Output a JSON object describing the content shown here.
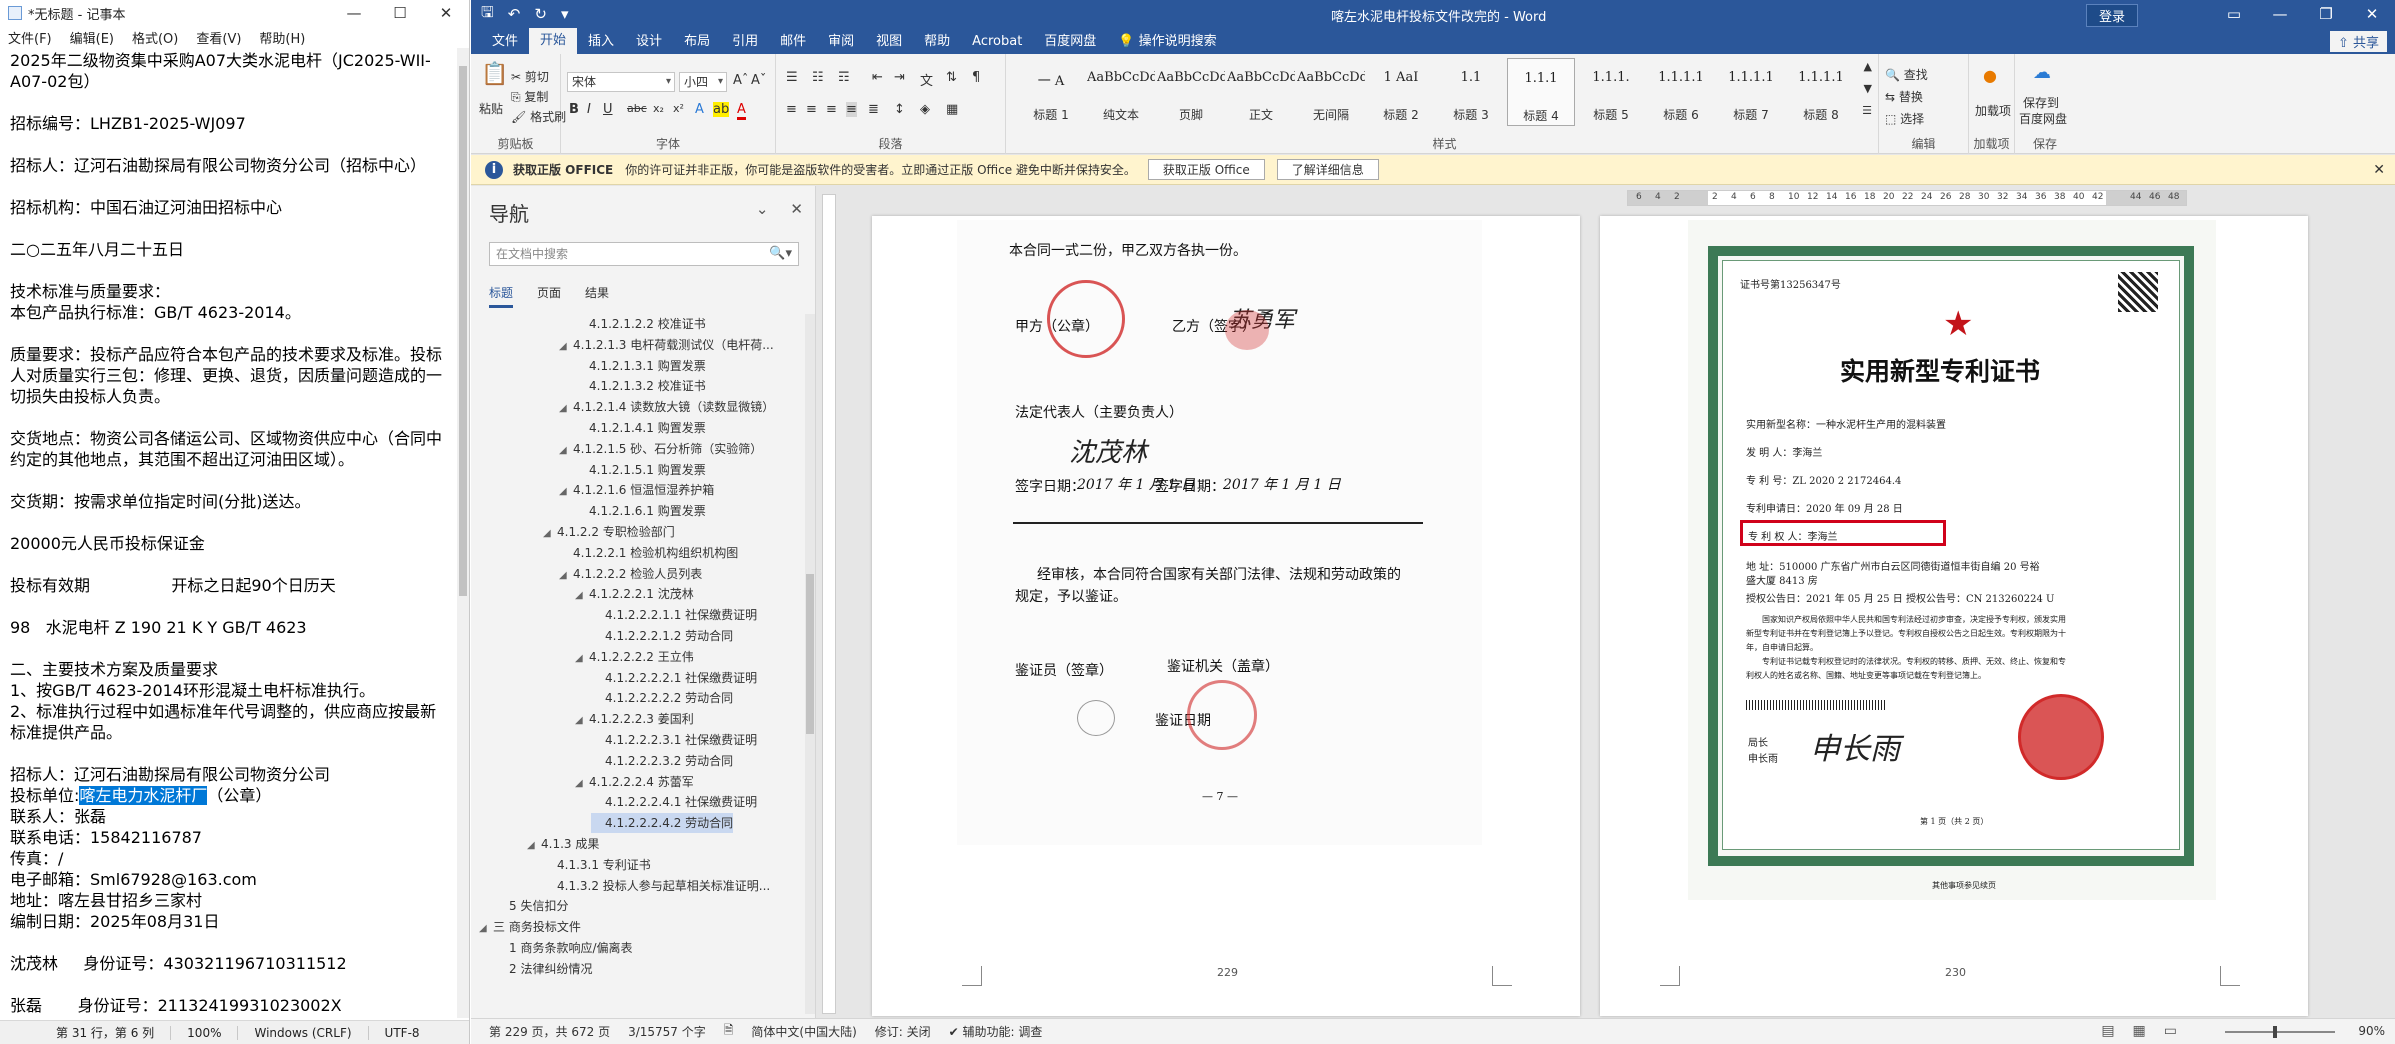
{
  "notepad": {
    "title": "*无标题 - 记事本",
    "menu": [
      "文件(F)",
      "编辑(E)",
      "格式(O)",
      "查看(V)",
      "帮助(H)"
    ],
    "lines": [
      "2025年二级物资集中采购A07大类水泥电杆（JC2025-WII-",
      "A07-02包）",
      "",
      "招标编号：LHZB1-2025-WJ097",
      "",
      "招标人：辽河石油勘探局有限公司物资分公司（招标中心）",
      "",
      "招标机构：中国石油辽河油田招标中心",
      "",
      "二○二五年八月二十五日",
      "",
      "技术标准与质量要求：",
      "本包产品执行标准：GB/T 4623-2014。",
      "",
      "质量要求：投标产品应符合本包产品的技术要求及标准。投标",
      "人对质量实行三包：修理、更换、退货，因质量问题造成的一",
      "切损失由投标人负责。",
      "",
      "交货地点：物资公司各储运公司、区域物资供应中心（合同中",
      "约定的其他地点，其范围不超出辽河油田区域）。",
      "",
      "交货期：按需求单位指定时间(分批)送达。",
      "",
      "20000元人民币投标保证金",
      "",
      "投标有效期                开标之日起90个日历天",
      "",
      "98   水泥电杆 Z 190 21 K Y GB/T 4623",
      "",
      "二、主要技术方案及质量要求",
      "1、按GB/T 4623-2014环形混凝土电杆标准执行。",
      "2、标准执行过程中如遇标准年代号调整的，供应商应按最新",
      "标准提供产品。",
      "",
      "招标人：辽河石油勘探局有限公司物资分公司"
    ],
    "bid_unit_prefix": "投标单位:",
    "bid_unit_selected": "喀左电力水泥杆厂",
    "bid_unit_suffix": "（公章）",
    "lines_after": [
      "联系人：张磊",
      "联系电话：15842116787",
      "传真：/",
      "电子邮箱：Sml67928@163.com",
      "地址：喀左县甘招乡三家村",
      "编制日期：2025年08月31日",
      "",
      "沈茂林     身份证号：430321196710311512",
      "",
      "张磊       身份证号：21132419931023002X"
    ],
    "status": {
      "position": "第 31 行，第 6 列",
      "zoom": "100%",
      "line_ending": "Windows (CRLF)",
      "encoding": "UTF-8"
    }
  },
  "word": {
    "doc_title": "喀左水泥电杆投标文件改完的 - Word",
    "login": "登录",
    "share": "共享",
    "tabs": [
      "文件",
      "开始",
      "插入",
      "设计",
      "布局",
      "引用",
      "邮件",
      "审阅",
      "视图",
      "帮助",
      "Acrobat",
      "百度网盘"
    ],
    "tell_me": "操作说明搜索",
    "ribbon": {
      "clipboard": {
        "label": "剪贴板",
        "paste": "粘贴",
        "cut": "剪切",
        "copy": "复制",
        "format_painter": "格式刷"
      },
      "font": {
        "label": "字体",
        "name": "宋体",
        "size": "小四"
      },
      "paragraph": {
        "label": "段落"
      },
      "styles": {
        "label": "样式",
        "items": [
          {
            "preview": "一  A",
            "name": "标题 1"
          },
          {
            "preview": "AaBbCcDd",
            "name": "纯文本"
          },
          {
            "preview": "AaBbCcDd",
            "name": "页脚"
          },
          {
            "preview": "AaBbCcDd",
            "name": "正文"
          },
          {
            "preview": "AaBbCcDd",
            "name": "无间隔"
          },
          {
            "preview": "1  AaI",
            "name": "标题 2"
          },
          {
            "preview": "1.1",
            "name": "标题 3"
          },
          {
            "preview": "1.1.1",
            "name": "标题 4"
          },
          {
            "preview": "1.1.1.",
            "name": "标题 5"
          },
          {
            "preview": "1.1.1.1",
            "name": "标题 6"
          },
          {
            "preview": "1.1.1.1",
            "name": "标题 7"
          },
          {
            "preview": "1.1.1.1",
            "name": "标题 8"
          }
        ]
      },
      "editing": {
        "label": "编辑",
        "find": "查找",
        "replace": "替换",
        "select": "选择"
      },
      "addins": {
        "label": "加载项",
        "btn": "加载项"
      },
      "save": {
        "label": "保存",
        "btn1": "保存到",
        "btn2": "百度网盘"
      }
    },
    "warning": {
      "title": "获取正版 OFFICE",
      "text": "你的许可证并非正版，你可能是盗版软件的受害者。立即通过正版 Office 避免中断并保持安全。",
      "btn1": "获取正版 Office",
      "btn2": "了解详细信息"
    },
    "nav": {
      "title": "导航",
      "search_placeholder": "在文档中搜索",
      "tabs": [
        "标题",
        "页面",
        "结果"
      ],
      "items": [
        {
          "text": "4.1.2.1.2.2 校准证书",
          "level": 6,
          "tw": ""
        },
        {
          "text": "4.1.2.1.3 电杆荷载测试仪（电杆荷...",
          "level": 5,
          "tw": "◢"
        },
        {
          "text": "4.1.2.1.3.1 购置发票",
          "level": 6,
          "tw": ""
        },
        {
          "text": "4.1.2.1.3.2 校准证书",
          "level": 6,
          "tw": ""
        },
        {
          "text": "4.1.2.1.4 读数放大镜（读数显微镜）",
          "level": 5,
          "tw": "◢"
        },
        {
          "text": "4.1.2.1.4.1 购置发票",
          "level": 6,
          "tw": ""
        },
        {
          "text": "4.1.2.1.5 砂、石分析筛（实验筛）",
          "level": 5,
          "tw": "◢"
        },
        {
          "text": "4.1.2.1.5.1 购置发票",
          "level": 6,
          "tw": ""
        },
        {
          "text": "4.1.2.1.6 恒温恒湿养护箱",
          "level": 5,
          "tw": "◢"
        },
        {
          "text": "4.1.2.1.6.1 购置发票",
          "level": 6,
          "tw": ""
        },
        {
          "text": "4.1.2.2 专职检验部门",
          "level": 4,
          "tw": "◢"
        },
        {
          "text": "4.1.2.2.1 检验机构组织机构图",
          "level": 5,
          "tw": ""
        },
        {
          "text": "4.1.2.2.2 检验人员列表",
          "level": 5,
          "tw": "◢"
        },
        {
          "text": "4.1.2.2.2.1 沈茂林",
          "level": 6,
          "tw": "◢"
        },
        {
          "text": "4.1.2.2.2.1.1 社保缴费证明",
          "level": 7,
          "tw": ""
        },
        {
          "text": "4.1.2.2.2.1.2 劳动合同",
          "level": 7,
          "tw": ""
        },
        {
          "text": "4.1.2.2.2.2 王立伟",
          "level": 6,
          "tw": "◢"
        },
        {
          "text": "4.1.2.2.2.2.1 社保缴费证明",
          "level": 7,
          "tw": ""
        },
        {
          "text": "4.1.2.2.2.2.2 劳动合同",
          "level": 7,
          "tw": ""
        },
        {
          "text": "4.1.2.2.2.3 姜国利",
          "level": 6,
          "tw": "◢"
        },
        {
          "text": "4.1.2.2.2.3.1 社保缴费证明",
          "level": 7,
          "tw": ""
        },
        {
          "text": "4.1.2.2.2.3.2 劳动合同",
          "level": 7,
          "tw": ""
        },
        {
          "text": "4.1.2.2.2.4 苏蕾军",
          "level": 6,
          "tw": "◢"
        },
        {
          "text": "4.1.2.2.2.4.1 社保缴费证明",
          "level": 7,
          "tw": ""
        },
        {
          "text": "4.1.2.2.2.4.2 劳动合同",
          "level": 7,
          "tw": "",
          "selected": true
        },
        {
          "text": "4.1.3 成果",
          "level": 3,
          "tw": "◢"
        },
        {
          "text": "4.1.3.1 专利证书",
          "level": 4,
          "tw": ""
        },
        {
          "text": "4.1.3.2 投标人参与起草相关标准证明...",
          "level": 4,
          "tw": ""
        },
        {
          "text": "5 失信扣分",
          "level": 1,
          "tw": ""
        },
        {
          "text": "三 商务投标文件",
          "level": 0,
          "tw": "◢"
        },
        {
          "text": "1 商务条款响应/偏离表",
          "level": 1,
          "tw": ""
        },
        {
          "text": "2 法律纠纷情况",
          "level": 1,
          "tw": ""
        }
      ]
    },
    "ruler_numbers": [
      "6",
      "4",
      "2",
      "",
      "2",
      "4",
      "6",
      "8",
      "10",
      "12",
      "14",
      "16",
      "18",
      "20",
      "22",
      "24",
      "26",
      "28",
      "30",
      "32",
      "34",
      "36",
      "38",
      "40",
      "42",
      "",
      "44",
      "46",
      "48"
    ],
    "page1": {
      "number": "229",
      "lines": [
        "本合同一式二份，甲乙双方各执一份。",
        "甲方（公章）",
        "乙方（签字）",
        "法定代表人（主要负责人）",
        "签字日期：",
        "签字日期：",
        "经审核，本合同符合国家有关部门法律、法规和劳动政策的",
        "规定，予以鉴证。",
        "鉴证员（签章）",
        "鉴证机关（盖章）",
        "鉴证日期",
        "— 7 —"
      ],
      "sig1": "苏勇军",
      "sig2": "沈茂林",
      "date1": "2017 年 1 月 1 日",
      "date2": "2017 年 1 月 1 日"
    },
    "page2": {
      "number": "230",
      "cert_no": "证书号第13256347号",
      "cert_title": "实用新型专利证书",
      "fields": [
        "实用新型名称：一种水泥杆生产用的混料装置",
        "发  明  人：李海兰",
        "专  利  号：ZL 2020 2 2172464.4",
        "专利申请日：2020 年 09 月 28 日",
        "专  利  权  人：李海兰",
        "地        址：510000 广东省广州市白云区同德街道恒丰街自编 20 号裕",
        "               盛大厦 8413 房",
        "授权公告日：2021 年 05 月 25 日        授权公告号：CN 213260224 U"
      ],
      "body_lines": [
        "国家知识产权局依照中华人民共和国专利法经过初步审查，决定授予专利权，颁发实用",
        "新型专利证书并在专利登记簿上予以登记。专利权自授权公告之日起生效。专利权期限为十",
        "年，自申请日起算。",
        "专利证书记载专利权登记时的法律状况。专利权的转移、质押、无效、终止、恢复和专",
        "利权人的姓名或名称、国籍、地址变更等事项记载在专利登记簿上。"
      ],
      "director_label1": "局长",
      "director_label2": "申长雨",
      "director_sig": "申长雨",
      "page_foot": "第 1 页（共 2 页）",
      "footer": "其他事项参见续页"
    },
    "status": {
      "page": "第 229 页，共 672 页",
      "words": "3/15757 个字",
      "lang": "简体中文(中国大陆)",
      "track": "修订: 关闭",
      "access": "辅助功能: 调查",
      "zoom": "90%"
    }
  }
}
